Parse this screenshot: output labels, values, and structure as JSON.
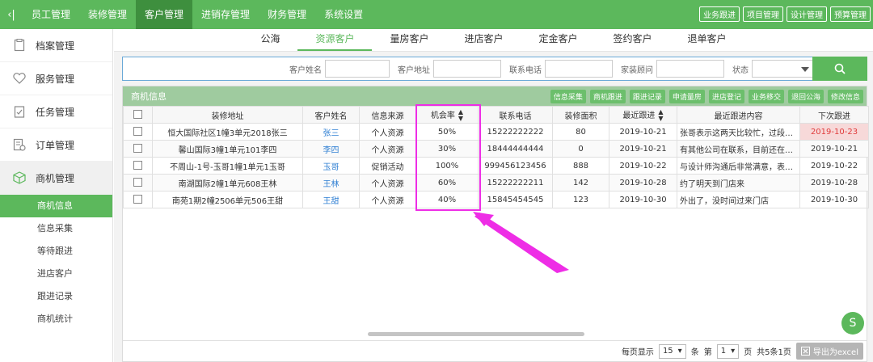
{
  "topnav": {
    "collapse_icon": "‹|",
    "items": [
      "员工管理",
      "装修管理",
      "客户管理",
      "进销存管理",
      "财务管理",
      "系统设置"
    ],
    "right_buttons": [
      "业务跟进",
      "项目管理",
      "设计管理",
      "预算管理"
    ]
  },
  "sidebar": {
    "items": [
      "档案管理",
      "服务管理",
      "任务管理",
      "订单管理",
      "商机管理"
    ],
    "sub_items": [
      "商机信息",
      "信息采集",
      "等待跟进",
      "进店客户",
      "跟进记录",
      "商机统计"
    ]
  },
  "subtabs": [
    "公海",
    "资源客户",
    "房客户",
    "进店客户",
    "定金客户",
    "签约客户",
    "退单客户"
  ],
  "subtabs_fixed": [
    "公海",
    "资源客户",
    "量房客户",
    "进店客户",
    "定金客户",
    "签约客户",
    "退单客户"
  ],
  "search": {
    "labels": [
      "客户姓名",
      "客户地址",
      "联系电话",
      "家装顾问",
      "状态"
    ]
  },
  "panel": {
    "title": "商机信息",
    "actions": [
      "信息采集",
      "商机跟进",
      "跟进记录",
      "申请量房",
      "进店登记",
      "业务移交",
      "退回公海",
      "修改信息"
    ]
  },
  "table": {
    "headers": [
      "装修地址",
      "客户姓名",
      "信息来源",
      "机会率",
      "联系电话",
      "装修面积",
      "最近跟进",
      "最近跟进内容",
      "下次跟进"
    ],
    "rows": [
      [
        "恒大国际社区1幢3单元2018张三",
        "张三",
        "个人资源",
        "50%",
        "15222222222",
        "80",
        "2019-10-21",
        "张哥表示这两天比较忙，过段时间再联系",
        "2019-10-23"
      ],
      [
        "馨山国际3幢1单元101李四",
        "李四",
        "个人资源",
        "30%",
        "18444444444",
        "0",
        "2019-10-21",
        "有其他公司在联系，目前还在对比中",
        "2019-10-21"
      ],
      [
        "不周山-1号-玉哥1幢1单元1玉哥",
        "玉哥",
        "促销活动",
        "100%",
        "999456123456",
        "888",
        "2019-10-22",
        "与设计师沟通后非常满意，表示愿意签约",
        "2019-10-22"
      ],
      [
        "南湖国际2幢1单元608王林",
        "王林",
        "个人资源",
        "60%",
        "15222222211",
        "142",
        "2019-10-28",
        "约了明天到门店来",
        "2019-10-28"
      ],
      [
        "南苑1期2幢2506单元506王甜",
        "王甜",
        "个人资源",
        "40%",
        "15845454545",
        "123",
        "2019-10-30",
        "外出了，没时间过来门店",
        "2019-10-30"
      ]
    ]
  },
  "pager": {
    "per_page_label": "每页显示",
    "per_page": "15",
    "unit_tiao": "条",
    "di": "第",
    "page": "1",
    "ye": "页",
    "summary": "共5条1页",
    "export": "导出为excel"
  },
  "colors": {
    "accent": "#5cb85c",
    "highlight": "#ee2de6",
    "overdue": "#e03c3c"
  }
}
